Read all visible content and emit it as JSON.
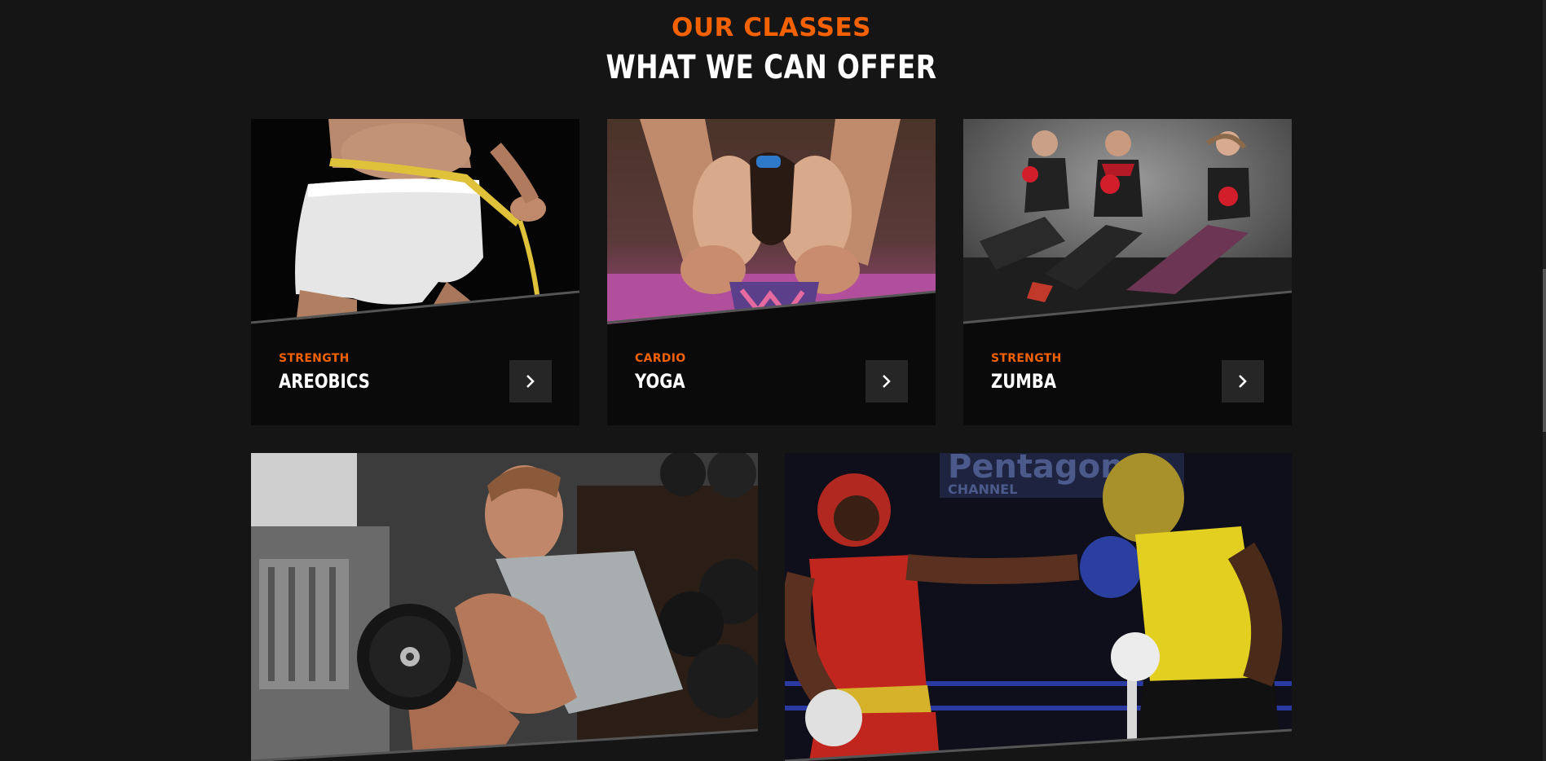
{
  "section": {
    "eyebrow": "OUR CLASSES",
    "title": "WHAT WE CAN OFFER"
  },
  "classes": [
    {
      "category": "STRENGTH",
      "name": "AREOBICS",
      "image": "waist-measuring-photo"
    },
    {
      "category": "CARDIO",
      "name": "YOGA",
      "image": "yoga-stretch-photo"
    },
    {
      "category": "STRENGTH",
      "name": "ZUMBA",
      "image": "group-kettlebell-photo"
    }
  ],
  "featured": [
    {
      "image": "dumbbell-curl-photo"
    },
    {
      "image": "boxing-match-photo"
    }
  ],
  "colors": {
    "accent": "#f36100",
    "background": "#151515",
    "card": "#0a0a0a",
    "button": "#262626"
  }
}
